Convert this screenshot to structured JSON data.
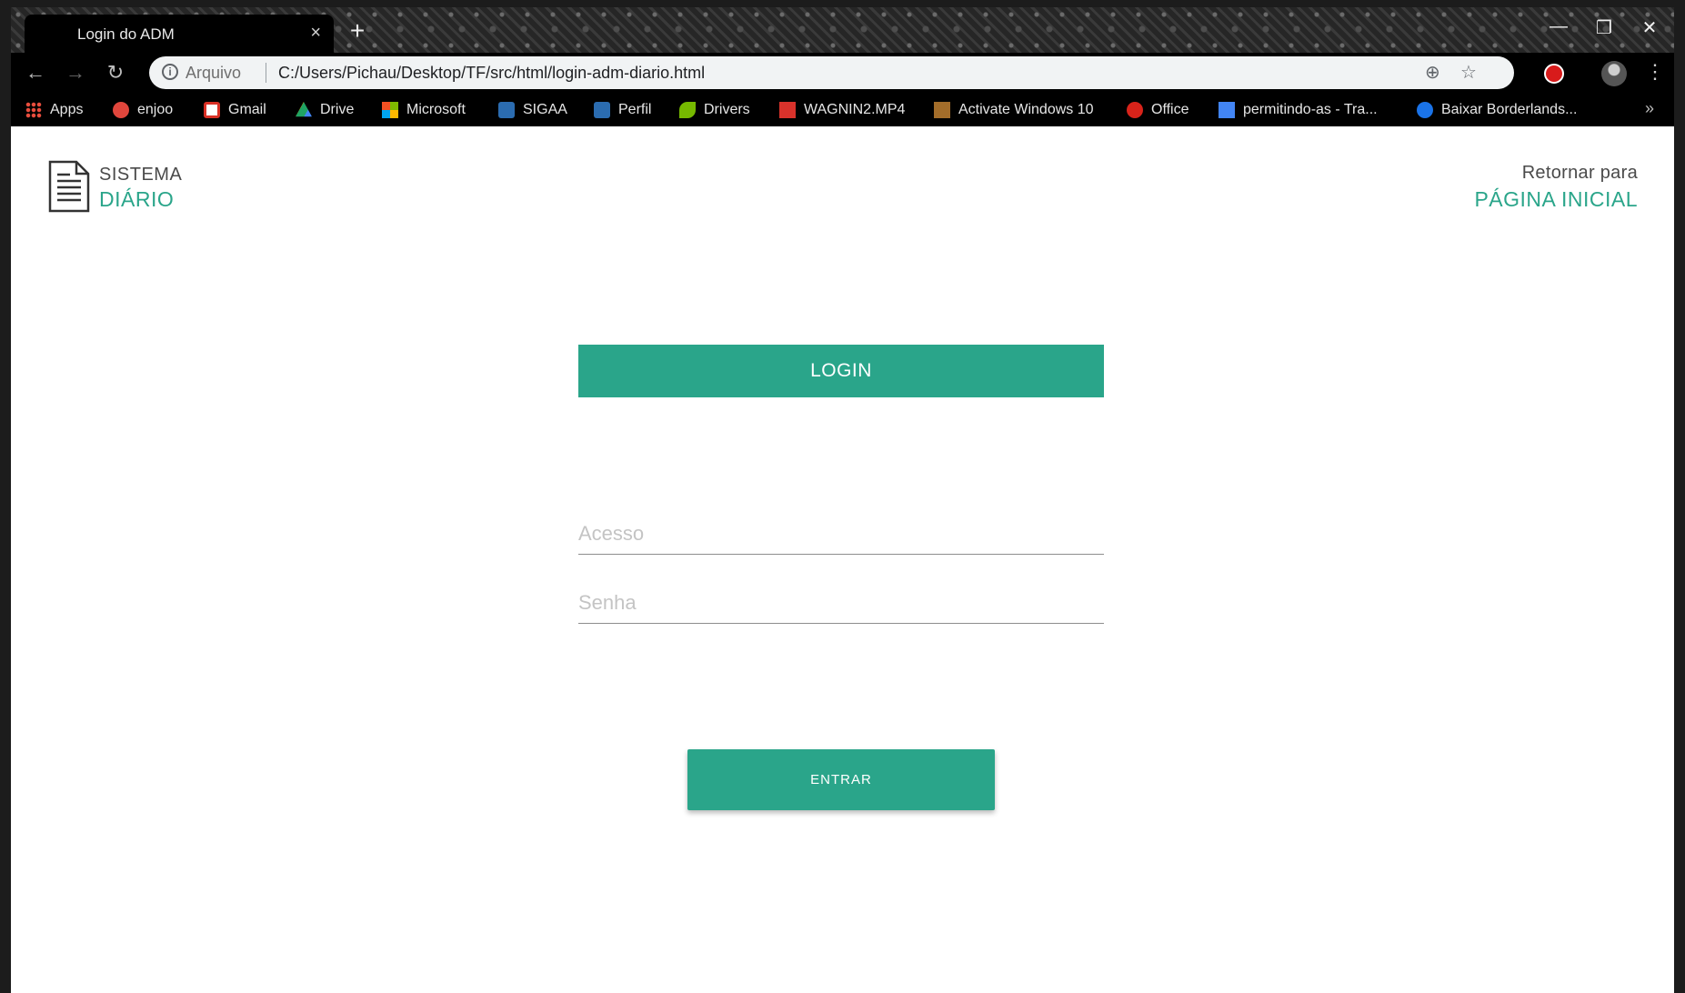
{
  "browser": {
    "tab_title": "Login do ADM",
    "tab_close": "×",
    "new_tab": "+",
    "window_controls": {
      "minimize": "—",
      "restore": "❐",
      "close": "✕"
    },
    "nav": {
      "back": "←",
      "forward": "→",
      "reload": "↻"
    },
    "omnibox": {
      "scheme_label": "Arquivo",
      "url": "C:/Users/Pichau/Desktop/TF/src/html/login-adm-diario.html",
      "zoom_icon": "⊕",
      "star_icon": "☆"
    },
    "menu": "⋮"
  },
  "bookmarks": {
    "items": [
      {
        "label": "Apps",
        "icon": "apps-grid-icon",
        "color": "#e84d3d"
      },
      {
        "label": "enjoo",
        "icon": "enjoo-icon",
        "color": "#e0463c"
      },
      {
        "label": "Gmail",
        "icon": "gmail-icon",
        "color": "#d93025"
      },
      {
        "label": "Drive",
        "icon": "drive-icon",
        "color": "#1fa463"
      },
      {
        "label": "Microsoft",
        "icon": "microsoft-icon",
        "color": "#f25022"
      },
      {
        "label": "SIGAA",
        "icon": "sigaa-icon",
        "color": "#2b6cb0"
      },
      {
        "label": "Perfil",
        "icon": "perfil-icon",
        "color": "#2b6cb0"
      },
      {
        "label": "Drivers",
        "icon": "nvidia-icon",
        "color": "#76b900"
      },
      {
        "label": "WAGNIN2.MP4",
        "icon": "video-icon",
        "color": "#d9322b"
      },
      {
        "label": "Activate Windows 10",
        "icon": "windows-icon",
        "color": "#a36d2a"
      },
      {
        "label": "Office",
        "icon": "office-icon",
        "color": "#d8231a"
      },
      {
        "label": "permitindo-as - Tra...",
        "icon": "translate-icon",
        "color": "#4285f4"
      },
      {
        "label": "Baixar Borderlands...",
        "icon": "download-icon",
        "color": "#1a73e8"
      }
    ],
    "more": "»"
  },
  "page": {
    "brand": {
      "top": "SISTEMA",
      "bottom": "DIÁRIO"
    },
    "return_link": {
      "top": "Retornar para",
      "bottom": "PÁGINA INICIAL"
    },
    "login_title": "LOGIN",
    "fields": {
      "access_placeholder": "Acesso",
      "password_placeholder": "Senha"
    },
    "submit_label": "ENTRAR",
    "accent_color": "#2aa58a"
  }
}
